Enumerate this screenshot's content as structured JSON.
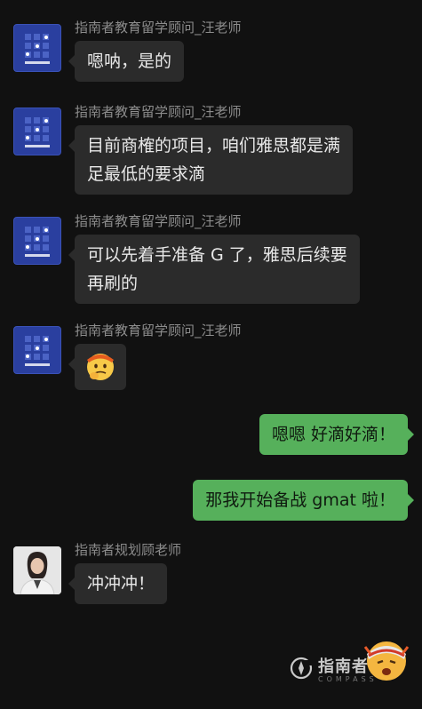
{
  "chat": {
    "messages": [
      {
        "sender": "指南者教育留学顾问_汪老师",
        "text": "嗯呐，是的"
      },
      {
        "sender": "指南者教育留学顾问_汪老师",
        "line1": "目前商榷的项目，咱们雅思都是满",
        "line2": "足最低的要求滴"
      },
      {
        "sender": "指南者教育留学顾问_汪老师",
        "line1": "可以先着手准备 G 了，雅思后续要",
        "line2": "再刷的"
      },
      {
        "sender": "指南者教育留学顾问_汪老师",
        "emoji": "thinking-face-emoji"
      },
      {
        "from": "me",
        "text": "嗯嗯 好滴好滴！"
      },
      {
        "from": "me",
        "text": "那我开始备战 gmat 啦！"
      },
      {
        "sender": "指南者规划顾老师",
        "text": "冲冲冲！"
      }
    ]
  },
  "watermark": {
    "text": "指南者留学",
    "sub": "COMPASS"
  },
  "colors": {
    "background": "#111111",
    "incoming_bubble": "#2b2b2b",
    "outgoing_bubble": "#56b05b",
    "logo_avatar": "#2a3f9f"
  }
}
